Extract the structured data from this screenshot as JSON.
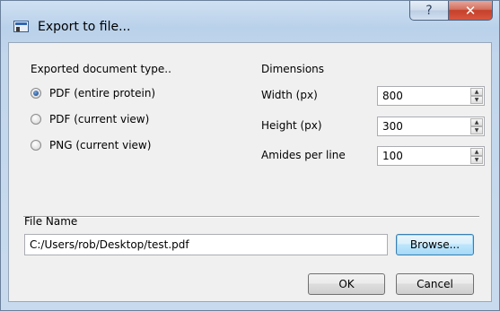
{
  "window": {
    "title": "Export to file...",
    "help_glyph": "?",
    "close_glyph": "✕"
  },
  "doc_type": {
    "heading": "Exported document type..",
    "options": [
      {
        "label": "PDF (entire protein)",
        "checked": true
      },
      {
        "label": "PDF (current view)",
        "checked": false
      },
      {
        "label": "PNG (current view)",
        "checked": false
      }
    ]
  },
  "dimensions": {
    "heading": "Dimensions",
    "fields": [
      {
        "label": "Width (px)",
        "value": "800"
      },
      {
        "label": "Height (px)",
        "value": "300"
      },
      {
        "label": "Amides per line",
        "value": "100"
      }
    ]
  },
  "file": {
    "heading": "File Name",
    "path": "C:/Users/rob/Desktop/test.pdf",
    "browse_label": "Browse..."
  },
  "actions": {
    "ok_label": "OK",
    "cancel_label": "Cancel"
  },
  "icons": {
    "window_icon": "window-icon",
    "spin_up": "spin-up-arrow-icon",
    "spin_down": "spin-down-arrow-icon"
  },
  "colors": {
    "titlebar": "#b9d1ea",
    "close_button": "#c5402a",
    "dialog_background": "#f0f0f0",
    "focus_border": "#3c7fb1"
  }
}
